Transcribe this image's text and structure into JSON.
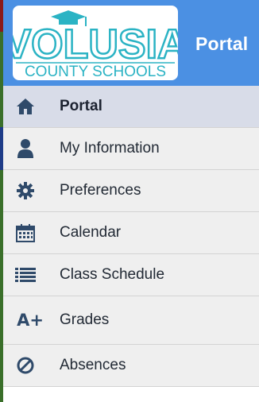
{
  "header": {
    "logo_text_main": "VOLUSIA",
    "logo_text_sub": "COUNTY SCHOOLS",
    "portal_title": "Portal"
  },
  "menu": {
    "items": [
      {
        "label": "Portal",
        "icon": "home-icon",
        "active": true
      },
      {
        "label": "My Information",
        "icon": "user-icon"
      },
      {
        "label": "Preferences",
        "icon": "gear-icon"
      },
      {
        "label": "Calendar",
        "icon": "calendar-icon"
      },
      {
        "label": "Class Schedule",
        "icon": "list-icon"
      },
      {
        "label": "Grades",
        "icon": "grades-icon",
        "icon_text": "A+"
      },
      {
        "label": "Absences",
        "icon": "absence-icon"
      }
    ]
  },
  "colors": {
    "header_bg": "#4b90e3",
    "icon": "#2f4a6a",
    "logo_teal": "#2bb3c4",
    "active_bg": "#d8dce8"
  }
}
